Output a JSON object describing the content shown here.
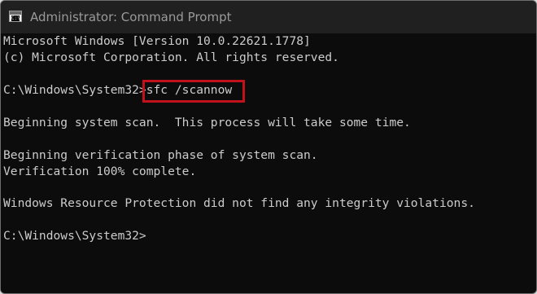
{
  "window": {
    "title": "Administrator: Command Prompt",
    "icon": "command-prompt-icon"
  },
  "console": {
    "lines": [
      "Microsoft Windows [Version 10.0.22621.1778]",
      "(c) Microsoft Corporation. All rights reserved.",
      "",
      "C:\\Windows\\System32>",
      "",
      "Beginning system scan.  This process will take some time.",
      "",
      "Beginning verification phase of system scan.",
      "Verification 100% complete.",
      "",
      "Windows Resource Protection did not find any integrity violations.",
      "",
      "C:\\Windows\\System32>"
    ],
    "command": "sfc /scannow"
  },
  "colors": {
    "terminal_bg": "#0c0c0c",
    "text": "#cccccc",
    "titlebar_bg": "#202020",
    "highlight_box": "#c1121b"
  }
}
